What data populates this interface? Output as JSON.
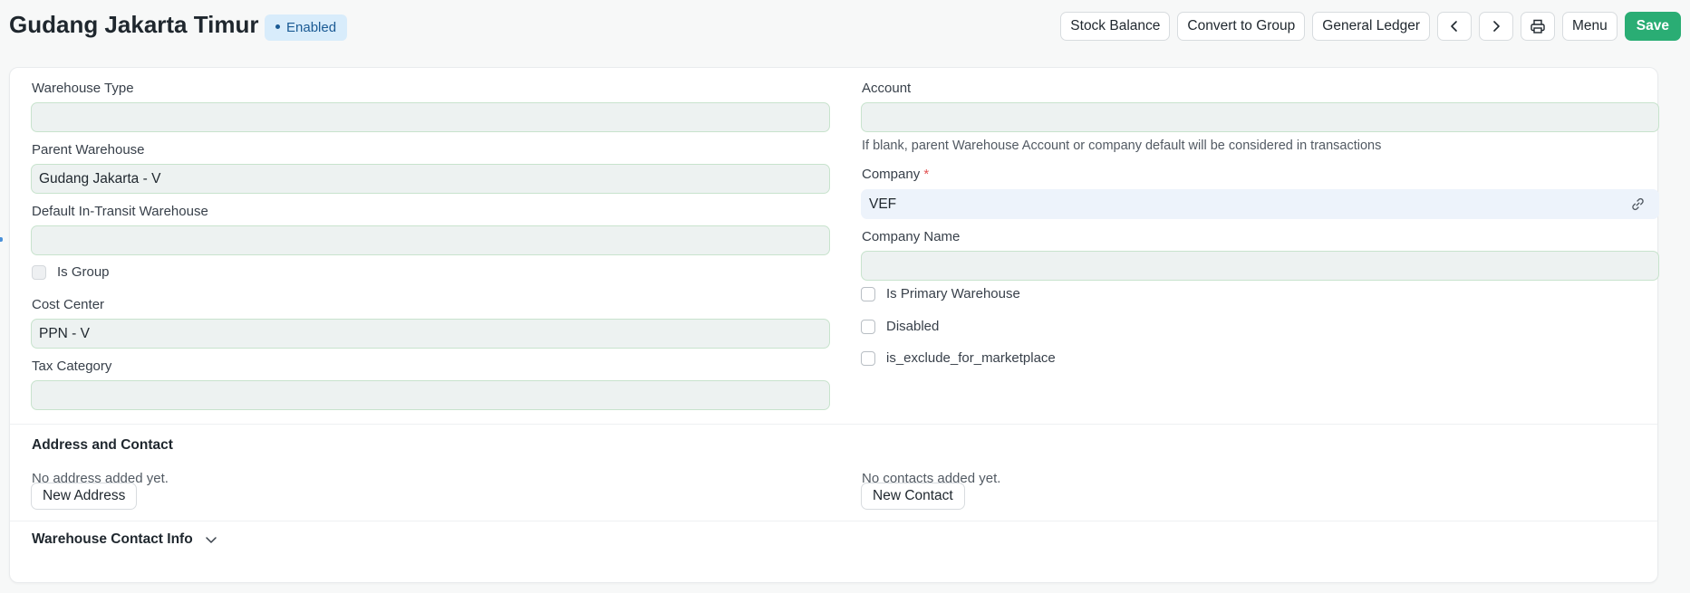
{
  "header": {
    "title": "Gudang Jakarta Timur",
    "status": "Enabled",
    "actions": {
      "stock_balance": "Stock Balance",
      "convert_to_group": "Convert to Group",
      "general_ledger": "General Ledger",
      "menu": "Menu",
      "save": "Save"
    }
  },
  "form": {
    "left": {
      "warehouse_type": {
        "label": "Warehouse Type",
        "value": ""
      },
      "parent_warehouse": {
        "label": "Parent Warehouse",
        "value": "Gudang Jakarta - V"
      },
      "default_in_transit": {
        "label": "Default In-Transit Warehouse",
        "value": ""
      },
      "is_group": {
        "label": "Is Group",
        "checked": false
      },
      "cost_center": {
        "label": "Cost Center",
        "value": "PPN - V"
      },
      "tax_category": {
        "label": "Tax Category",
        "value": ""
      }
    },
    "right": {
      "account": {
        "label": "Account",
        "value": "",
        "help": "If blank, parent Warehouse Account or company default will be considered in transactions"
      },
      "company": {
        "label": "Company",
        "required_mark": "*",
        "value": "VEF"
      },
      "company_name": {
        "label": "Company Name",
        "value": ""
      },
      "is_primary_warehouse": {
        "label": "Is Primary Warehouse",
        "checked": false
      },
      "disabled": {
        "label": "Disabled",
        "checked": false
      },
      "is_exclude_for_marketplace": {
        "label": "is_exclude_for_marketplace",
        "checked": false
      }
    }
  },
  "address_contact": {
    "title": "Address and Contact",
    "no_address": "No address added yet.",
    "new_address": "New Address",
    "no_contacts": "No contacts added yet.",
    "new_contact": "New Contact"
  },
  "warehouse_contact_info": {
    "title": "Warehouse Contact Info"
  },
  "icons": {
    "prev": "chevron-left-icon",
    "next": "chevron-right-icon",
    "print": "printer-icon",
    "link": "link-icon",
    "collapse": "chevron-down-icon"
  },
  "colors": {
    "primary": "#2aad74",
    "status_bg": "#d8ecfb",
    "status_text": "#1a5a94",
    "input_bg": "#edf2f1",
    "required": "#e25454"
  }
}
